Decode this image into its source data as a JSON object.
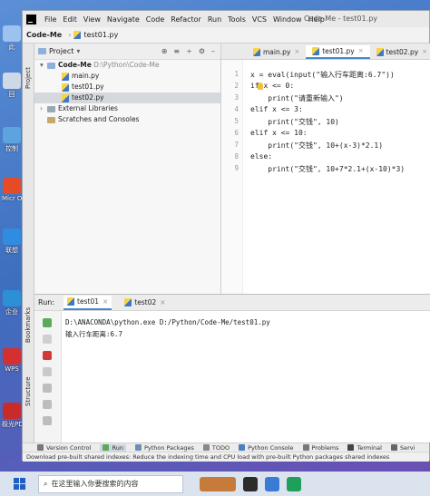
{
  "app": {
    "window_title": "Code-Me - test01.py"
  },
  "menu": [
    "File",
    "Edit",
    "View",
    "Navigate",
    "Code",
    "Refactor",
    "Run",
    "Tools",
    "VCS",
    "Window",
    "Help"
  ],
  "navbar": {
    "project": "Code-Me",
    "file": "test01.py"
  },
  "desktop_icons": [
    "此",
    "回",
    "控制",
    "Micr Office",
    "联想",
    "企业",
    "WPS",
    "极光PDF"
  ],
  "left_strip": {
    "project": "Project",
    "structure": "Structure",
    "bookmarks": "Bookmarks"
  },
  "project_panel": {
    "title": "Project",
    "tree": [
      {
        "label": "Code-Me",
        "detail": "D:\\Python\\Code-Me",
        "kind": "folder"
      },
      {
        "label": "main.py",
        "kind": "file"
      },
      {
        "label": "test01.py",
        "kind": "file"
      },
      {
        "label": "test02.py",
        "kind": "file",
        "selected": true
      },
      {
        "label": "External Libraries",
        "kind": "lib"
      },
      {
        "label": "Scratches and Consoles",
        "kind": "scratch"
      }
    ]
  },
  "editor": {
    "tabs": [
      {
        "label": "main.py",
        "active": false
      },
      {
        "label": "test01.py",
        "active": true
      },
      {
        "label": "test02.py",
        "active": false
      }
    ],
    "line_numbers": [
      "1",
      "2",
      "3",
      "4",
      "5",
      "6",
      "7",
      "8",
      "9"
    ],
    "lines": [
      "x = eval(input(\"输入行车距离:6.7\"))",
      "if x <= 0:",
      "    print(\"请重新输入\")",
      "elif x <= 3:",
      "    print(\"交钱\", 10)",
      "elif x <= 10:",
      "    print(\"交钱\", 10+(x-3)*2.1)",
      "else:",
      "    print(\"交钱\", 10+7*2.1+(x-10)*3)"
    ]
  },
  "run_panel": {
    "label": "Run:",
    "tabs": [
      {
        "label": "test01",
        "active": true
      },
      {
        "label": "test02",
        "active": false
      }
    ],
    "console": [
      "D:\\ANACONDA\\python.exe D:/Python/Code-Me/test01.py",
      "输入行车距离:6.7"
    ]
  },
  "bottom_toolbar": [
    "Version Control",
    "Run",
    "Python Packages",
    "TODO",
    "Python Console",
    "Problems",
    "Terminal",
    "Servi"
  ],
  "status": "Download pre-built shared indexes: Reduce the indexing time and CPU load with pre-built Python packages shared indexes",
  "taskbar": {
    "search_placeholder": "在这里输入你要搜索的内容"
  }
}
